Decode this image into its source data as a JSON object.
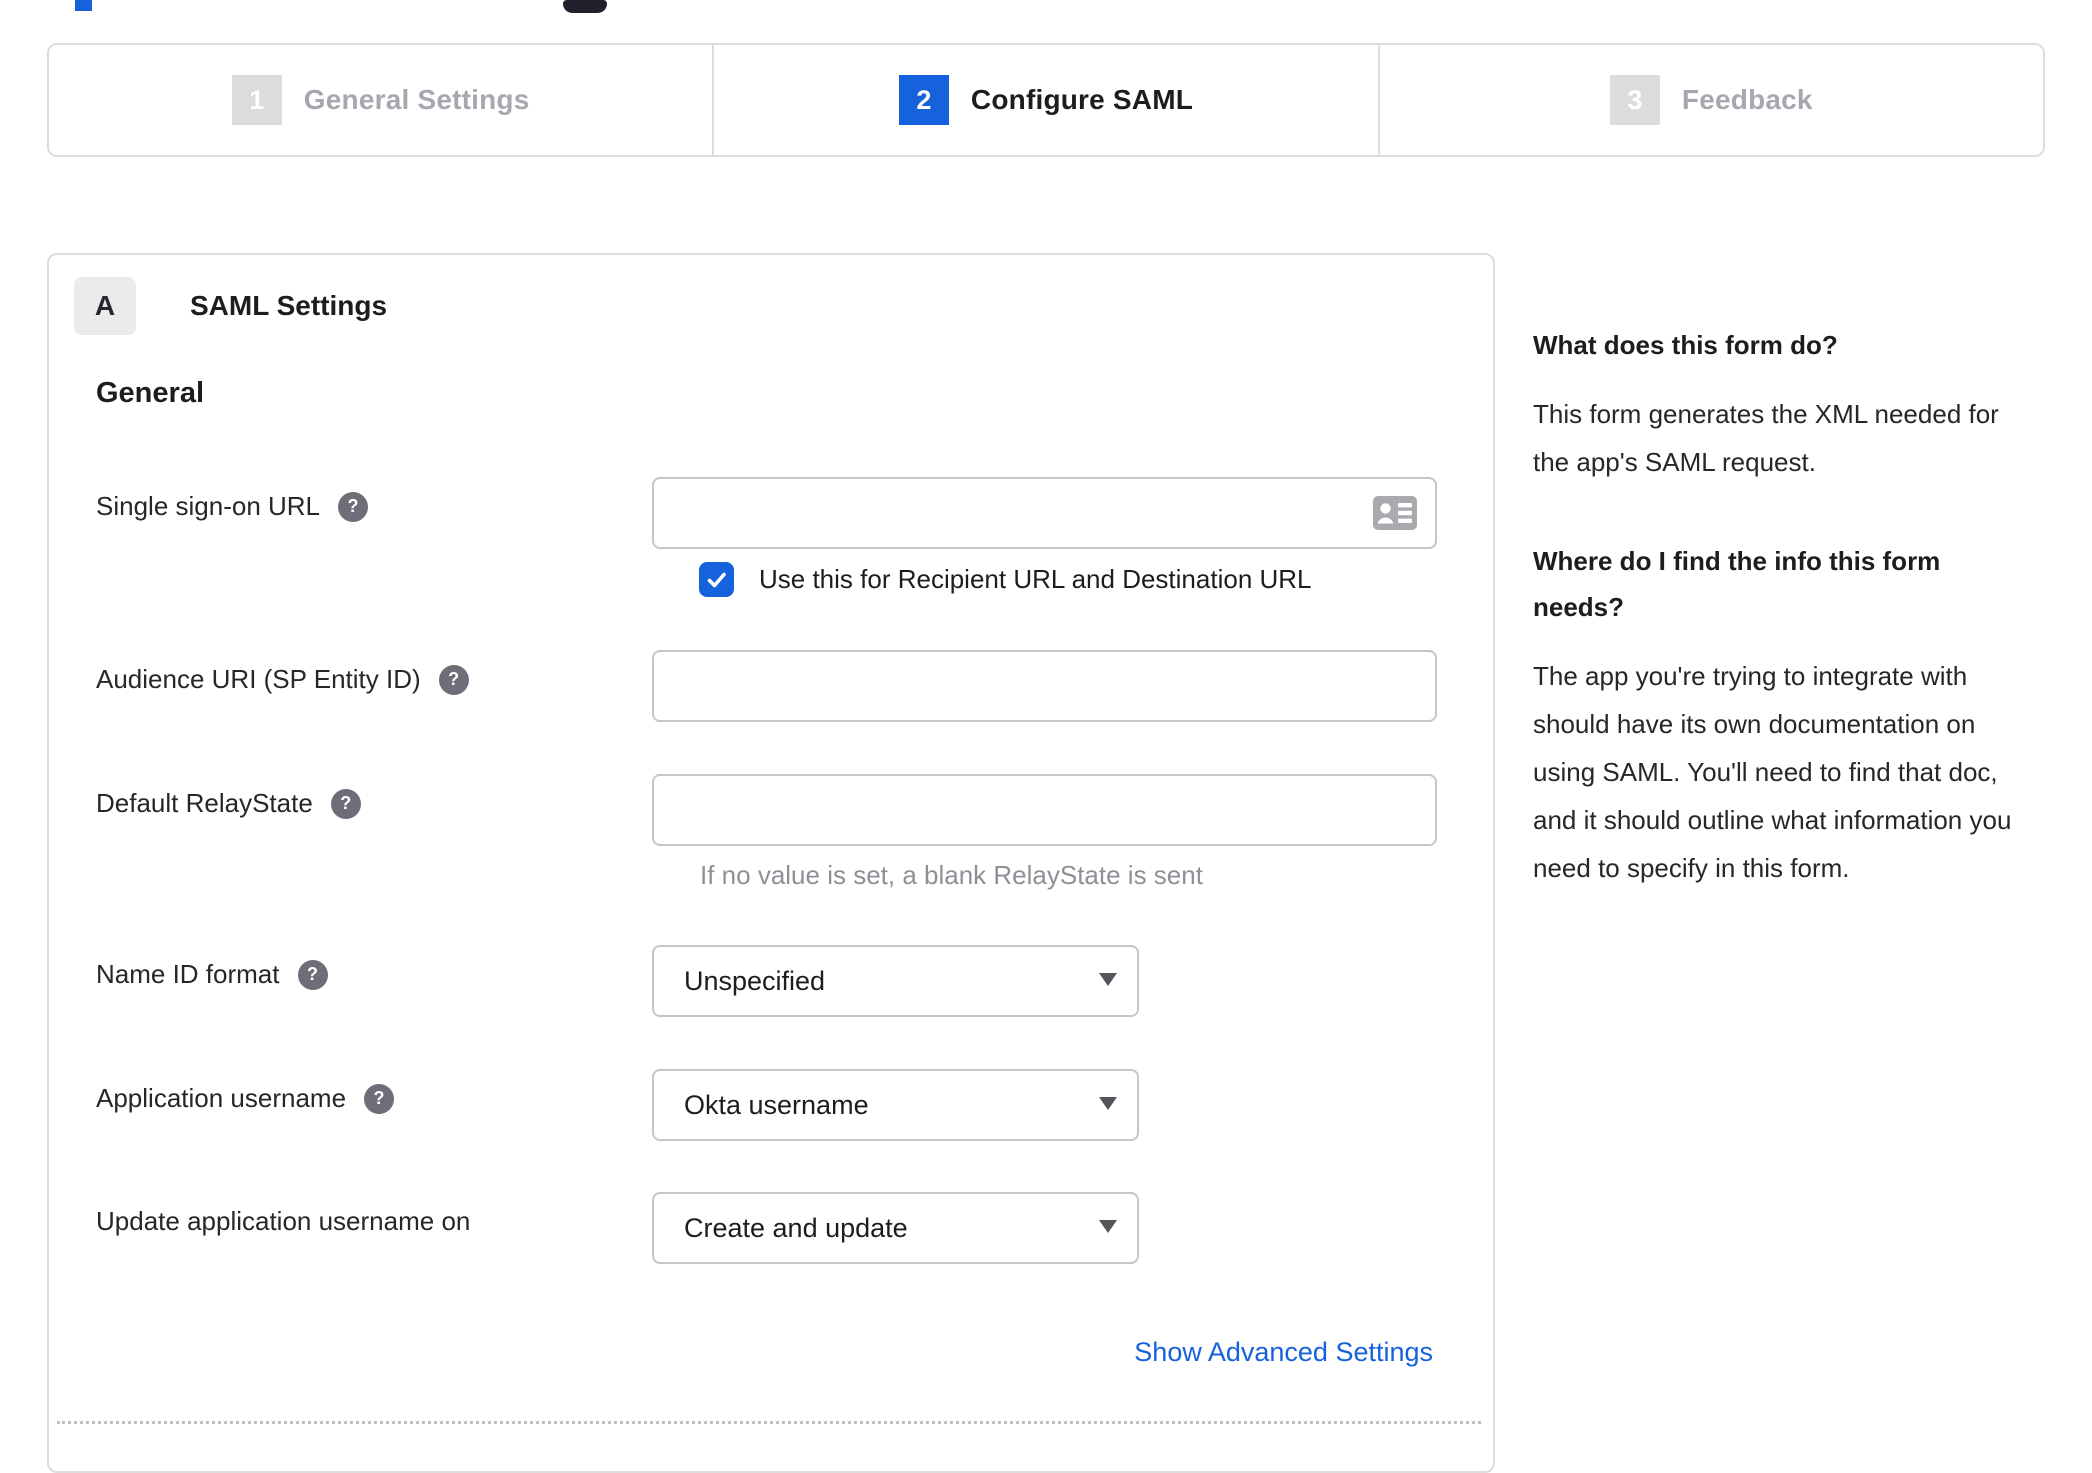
{
  "colors": {
    "accent_blue": "#1662dd",
    "text_dark": "#1d1d21",
    "muted_gray": "#8f8f97",
    "border_gray": "#dddde0"
  },
  "stepper": {
    "step1": {
      "number": "1",
      "label": "General Settings",
      "state": "inactive"
    },
    "step2": {
      "number": "2",
      "label": "Configure SAML",
      "state": "active"
    },
    "step3": {
      "number": "3",
      "label": "Feedback",
      "state": "inactive"
    }
  },
  "form": {
    "section_badge": "A",
    "section_title": "SAML Settings",
    "group_heading": "General",
    "sso_url": {
      "label": "Single sign-on URL",
      "value": "",
      "checkbox_label": "Use this for Recipient URL and Destination URL",
      "checkbox_checked": true
    },
    "audience_uri": {
      "label": "Audience URI (SP Entity ID)",
      "value": ""
    },
    "default_relay_state": {
      "label": "Default RelayState",
      "value": "",
      "hint": "If no value is set, a blank RelayState is sent"
    },
    "name_id_format": {
      "label": "Name ID format",
      "value": "Unspecified"
    },
    "application_username": {
      "label": "Application username",
      "value": "Okta username"
    },
    "update_application_username_on": {
      "label": "Update application username on",
      "value": "Create and update"
    },
    "advanced_link": "Show Advanced Settings"
  },
  "help_panel": {
    "q1_title": "What does this form do?",
    "q1_body": "This form generates the XML needed for the app's SAML request.",
    "q2_title": "Where do I find the info this form needs?",
    "q2_body": "The app you're trying to integrate with should have its own documentation on using SAML. You'll need to find that doc, and it should outline what information you need to specify in this form."
  }
}
